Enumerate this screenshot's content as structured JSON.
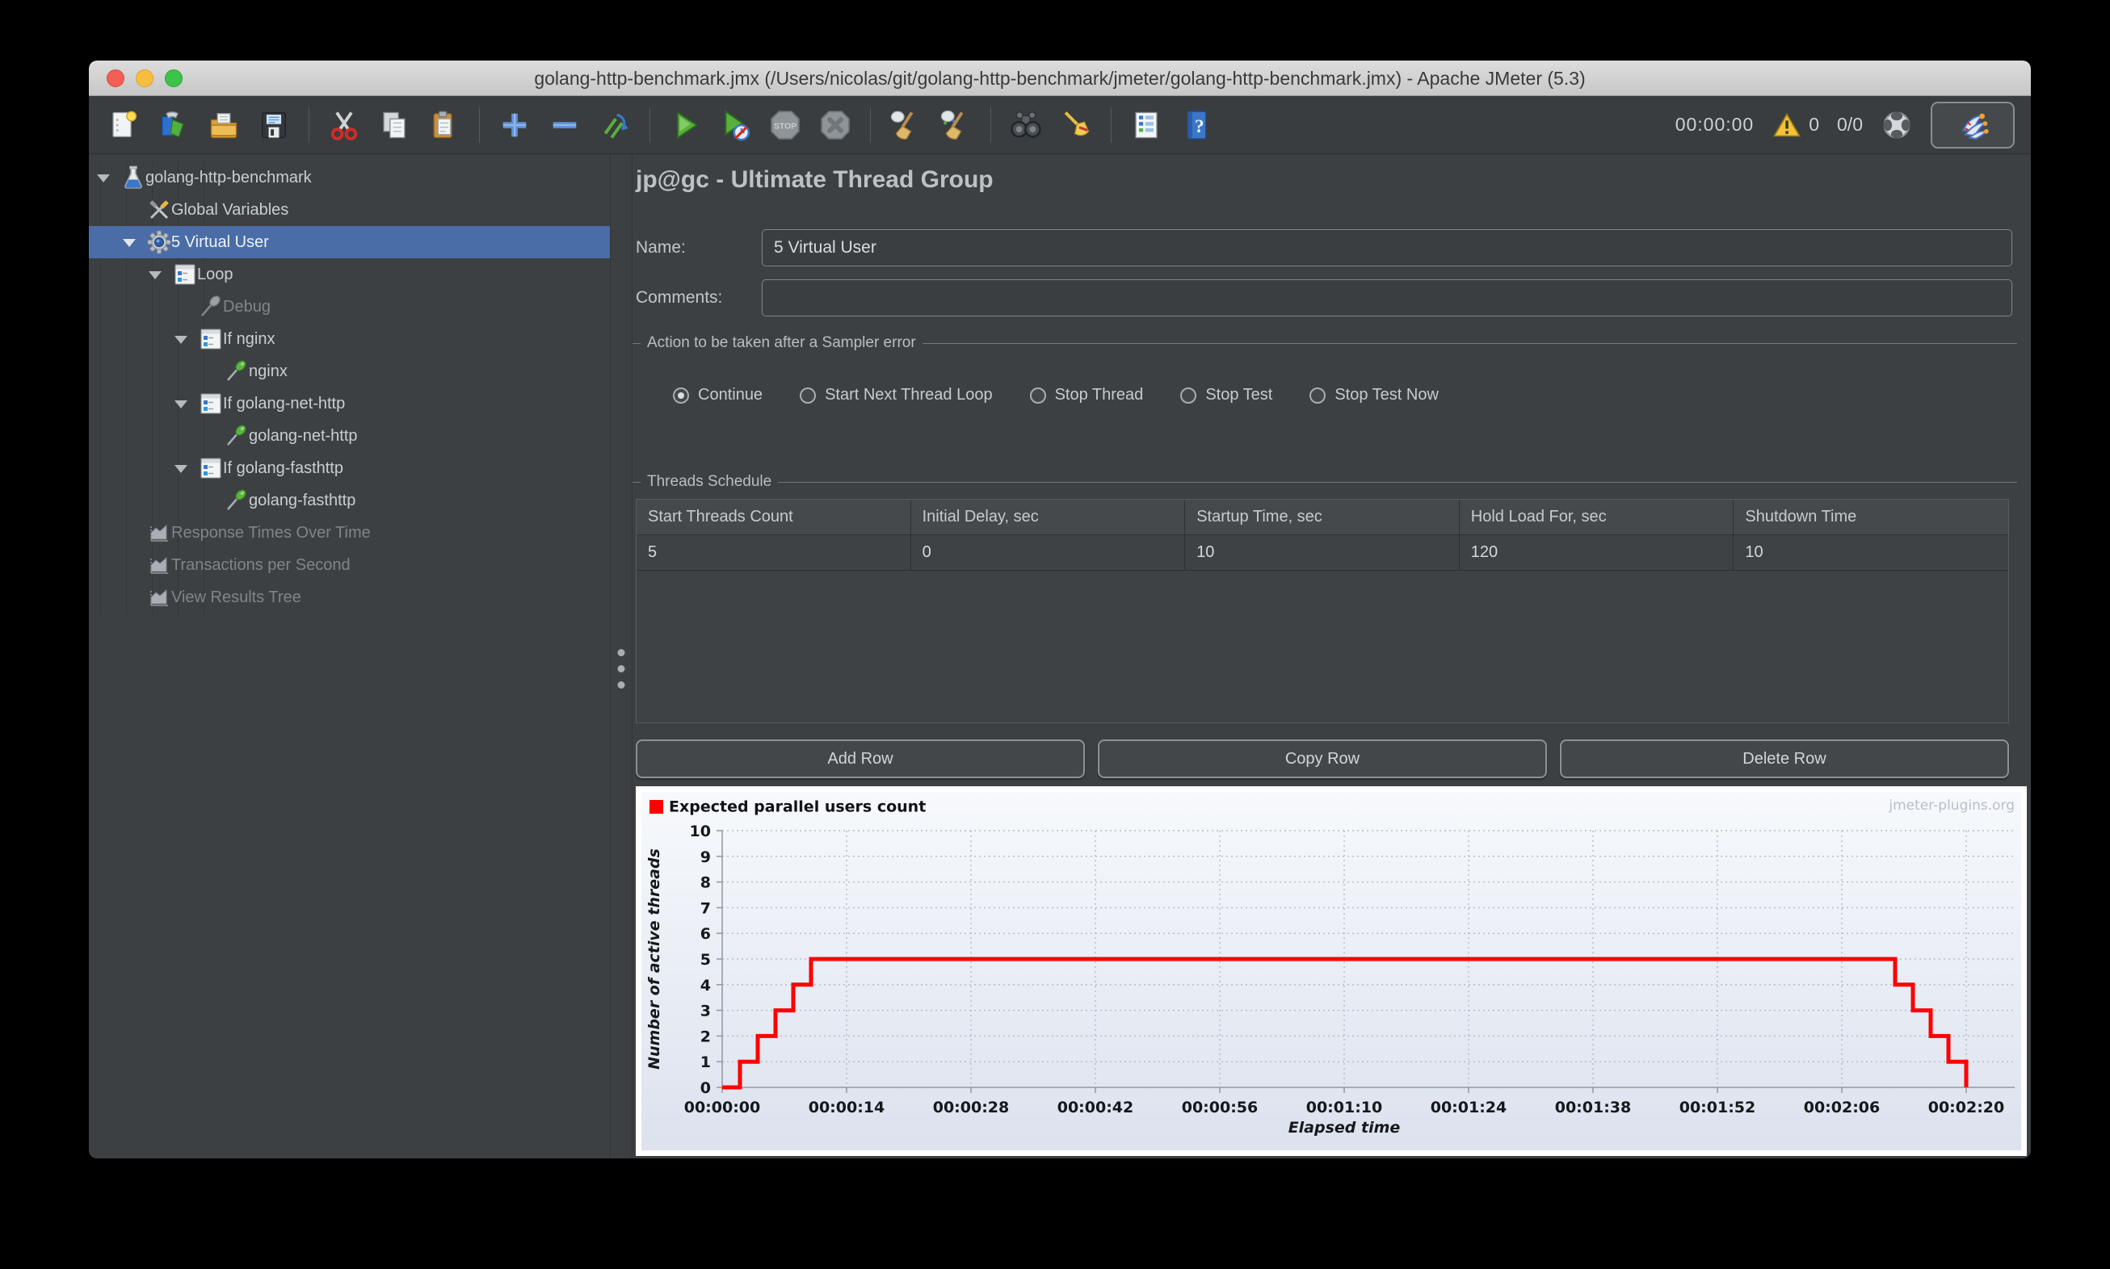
{
  "window": {
    "title": "golang-http-benchmark.jmx (/Users/nicolas/git/golang-http-benchmark/jmeter/golang-http-benchmark.jmx) - Apache JMeter (5.3)"
  },
  "toolbar": {
    "items": [
      {
        "icon": "new-file"
      },
      {
        "icon": "templates"
      },
      {
        "icon": "open-file"
      },
      {
        "icon": "save"
      },
      {
        "sep": true
      },
      {
        "icon": "cut"
      },
      {
        "icon": "copy"
      },
      {
        "icon": "paste"
      },
      {
        "sep": true
      },
      {
        "icon": "add"
      },
      {
        "icon": "remove"
      },
      {
        "icon": "reset"
      },
      {
        "sep": true
      },
      {
        "icon": "start"
      },
      {
        "icon": "start-no-pauses"
      },
      {
        "icon": "stop"
      },
      {
        "icon": "shutdown"
      },
      {
        "sep": true
      },
      {
        "icon": "clear"
      },
      {
        "icon": "clear-all"
      },
      {
        "sep": true
      },
      {
        "icon": "search"
      },
      {
        "icon": "search-reset"
      },
      {
        "sep": true
      },
      {
        "icon": "function-helper"
      },
      {
        "icon": "help"
      }
    ],
    "timer": "00:00:00",
    "warning_count": "0",
    "thread_count": "0/0"
  },
  "tree": {
    "items": [
      {
        "label": "golang-http-benchmark",
        "level": 0,
        "icon": "test-plan",
        "expanded": true
      },
      {
        "label": "Global Variables",
        "level": 1,
        "icon": "arguments"
      },
      {
        "label": "5 Virtual User",
        "level": 1,
        "icon": "thread-group",
        "expanded": true,
        "selected": true
      },
      {
        "label": "Loop",
        "level": 2,
        "icon": "controller",
        "expanded": true
      },
      {
        "label": "Debug",
        "level": 3,
        "icon": "sampler-disabled",
        "disabled": true
      },
      {
        "label": "If nginx",
        "level": 3,
        "icon": "controller",
        "expanded": true
      },
      {
        "label": "nginx",
        "level": 4,
        "icon": "sampler"
      },
      {
        "label": "If golang-net-http",
        "level": 3,
        "icon": "controller",
        "expanded": true
      },
      {
        "label": "golang-net-http",
        "level": 4,
        "icon": "sampler"
      },
      {
        "label": "If golang-fasthttp",
        "level": 3,
        "icon": "controller",
        "expanded": true
      },
      {
        "label": "golang-fasthttp",
        "level": 4,
        "icon": "sampler"
      },
      {
        "label": "Response Times Over Time",
        "level": 1,
        "icon": "listener",
        "disabled": true
      },
      {
        "label": "Transactions per Second",
        "level": 1,
        "icon": "listener",
        "disabled": true
      },
      {
        "label": "View Results Tree",
        "level": 1,
        "icon": "listener",
        "disabled": true
      }
    ]
  },
  "main": {
    "panel_title": "jp@gc - Ultimate Thread Group",
    "name_label": "Name:",
    "name_value": "5 Virtual User",
    "comments_label": "Comments:",
    "comments_value": "",
    "error_action": {
      "title": "Action to be taken after a Sampler error",
      "options": [
        {
          "label": "Continue",
          "selected": true
        },
        {
          "label": "Start Next Thread Loop",
          "selected": false
        },
        {
          "label": "Stop Thread",
          "selected": false
        },
        {
          "label": "Stop Test",
          "selected": false
        },
        {
          "label": "Stop Test Now",
          "selected": false
        }
      ]
    },
    "schedule": {
      "title": "Threads Schedule",
      "columns": [
        "Start Threads Count",
        "Initial Delay, sec",
        "Startup Time, sec",
        "Hold Load For, sec",
        "Shutdown Time"
      ],
      "rows": [
        [
          "5",
          "0",
          "10",
          "120",
          "10"
        ]
      ]
    },
    "row_buttons": [
      "Add Row",
      "Copy Row",
      "Delete Row"
    ]
  },
  "chart_data": {
    "type": "line",
    "title": "",
    "legend": "Expected parallel users count",
    "watermark": "jmeter-plugins.org",
    "xlabel": "Elapsed time",
    "ylabel": "Number of active threads",
    "xlim_seconds": [
      0,
      140
    ],
    "ylim": [
      0,
      10
    ],
    "grid": "dotted",
    "legend_position": "top-left",
    "x_ticks": [
      {
        "t": 0,
        "label": "00:00:00"
      },
      {
        "t": 14,
        "label": "00:00:14"
      },
      {
        "t": 28,
        "label": "00:00:28"
      },
      {
        "t": 42,
        "label": "00:00:42"
      },
      {
        "t": 56,
        "label": "00:00:56"
      },
      {
        "t": 70,
        "label": "00:01:10"
      },
      {
        "t": 84,
        "label": "00:01:24"
      },
      {
        "t": 98,
        "label": "00:01:38"
      },
      {
        "t": 112,
        "label": "00:01:52"
      },
      {
        "t": 126,
        "label": "00:02:06"
      },
      {
        "t": 140,
        "label": "00:02:20"
      }
    ],
    "y_ticks": [
      0,
      1,
      2,
      3,
      4,
      5,
      6,
      7,
      8,
      9,
      10
    ],
    "series": [
      {
        "name": "Expected parallel users count",
        "color": "#ff0000",
        "points": [
          [
            0,
            0
          ],
          [
            2,
            0
          ],
          [
            2,
            1
          ],
          [
            4,
            1
          ],
          [
            4,
            2
          ],
          [
            6,
            2
          ],
          [
            6,
            3
          ],
          [
            8,
            3
          ],
          [
            8,
            4
          ],
          [
            10,
            4
          ],
          [
            10,
            5
          ],
          [
            132,
            5
          ],
          [
            132,
            4
          ],
          [
            134,
            4
          ],
          [
            134,
            3
          ],
          [
            136,
            3
          ],
          [
            136,
            2
          ],
          [
            138,
            2
          ],
          [
            138,
            1
          ],
          [
            140,
            1
          ],
          [
            140,
            0
          ]
        ]
      }
    ]
  }
}
